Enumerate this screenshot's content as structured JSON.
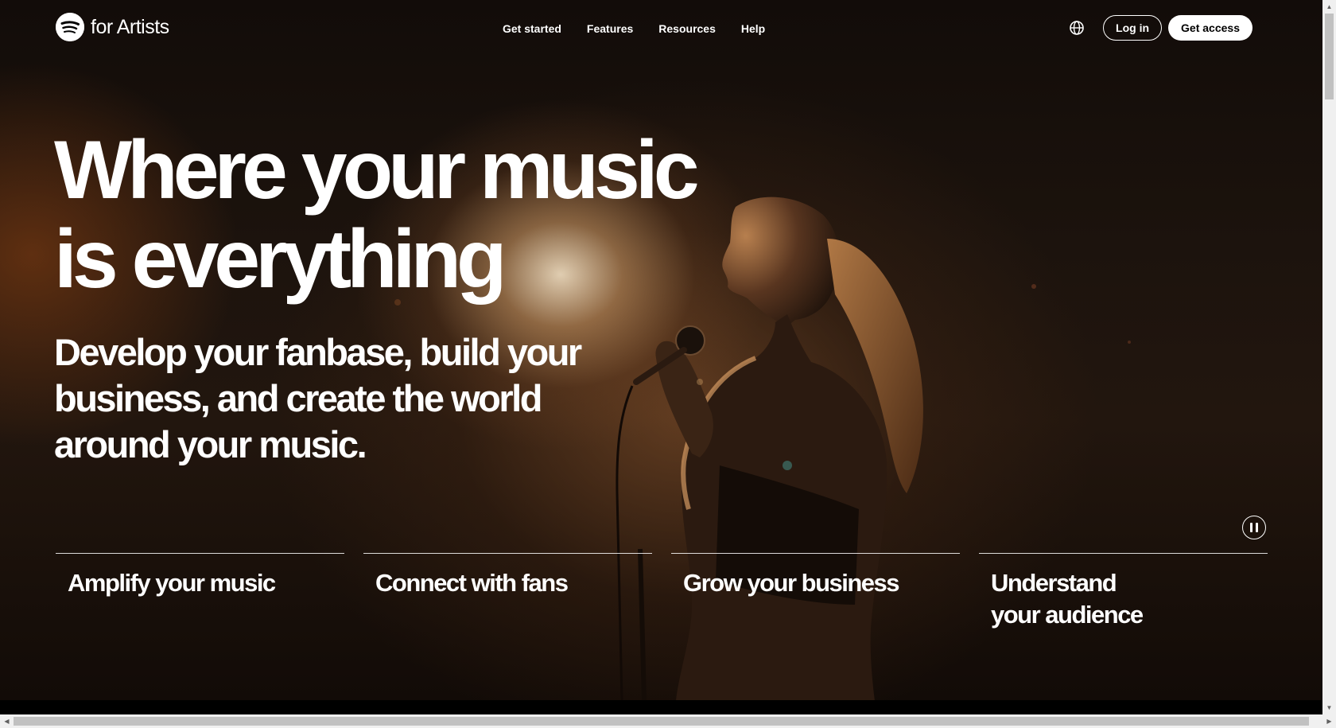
{
  "nav": {
    "logo_text": "for Artists",
    "links": [
      "Get started",
      "Features",
      "Resources",
      "Help"
    ],
    "login_label": "Log in",
    "access_label": "Get access"
  },
  "hero": {
    "title_line1": "Where your music",
    "title_line2": "is everything",
    "subtitle_line1": "Develop your fanbase, build your",
    "subtitle_line2": "business, and create the world",
    "subtitle_line3": "around your music."
  },
  "features": [
    "Amplify your music",
    "Connect with fans",
    "Grow your business",
    "Understand\nyour audience"
  ],
  "colors": {
    "text": "#ffffff",
    "accent_button": "#ffffff",
    "background": "#120c09"
  },
  "icons": {
    "logo": "spotify-icon",
    "language": "globe-icon",
    "media": "pause-icon"
  }
}
